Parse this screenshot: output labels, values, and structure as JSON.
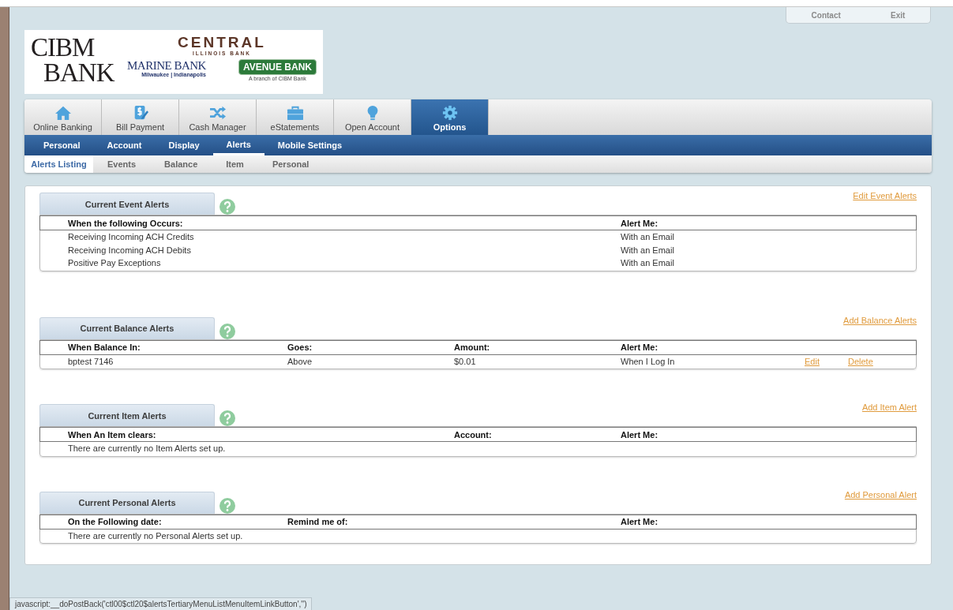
{
  "top_links": [
    {
      "label": "Contact"
    },
    {
      "label": "Exit"
    }
  ],
  "logo": {
    "cibm_line1": "CIBM",
    "cibm_line2": "BANK",
    "central": "CENTRAL",
    "central_sub": "ILLINOIS BANK",
    "marine": "MARINE BANK",
    "marine_sub": "Milwaukee | Indianapolis",
    "avenue": "AVENUE BANK",
    "avenue_sub": "A branch of CIBM Bank"
  },
  "main_tabs": [
    {
      "label": "Online Banking",
      "selected": false
    },
    {
      "label": "Bill Payment",
      "selected": false
    },
    {
      "label": "Cash Manager",
      "selected": false
    },
    {
      "label": "eStatements",
      "selected": false
    },
    {
      "label": "Open Account",
      "selected": false
    },
    {
      "label": "Options",
      "selected": true
    }
  ],
  "secondary_tabs": [
    {
      "label": "Personal",
      "selected": false
    },
    {
      "label": "Account",
      "selected": false
    },
    {
      "label": "Display",
      "selected": false
    },
    {
      "label": "Alerts",
      "selected": true
    },
    {
      "label": "Mobile Settings",
      "selected": false
    }
  ],
  "tertiary_tabs": [
    {
      "label": "Alerts Listing",
      "selected": true
    },
    {
      "label": "Events",
      "selected": false
    },
    {
      "label": "Balance",
      "selected": false
    },
    {
      "label": "Item",
      "selected": false
    },
    {
      "label": "Personal",
      "selected": false
    }
  ],
  "sections": [
    {
      "kind": "event",
      "title": "Current Event Alerts",
      "link": "Edit Event Alerts",
      "columns": [
        "When the following Occurs:",
        "Alert Me:"
      ],
      "rows": [
        {
          "cells": [
            "Receiving Incoming ACH Credits",
            "With an Email"
          ]
        },
        {
          "cells": [
            "Receiving Incoming ACH Debits",
            "With an Email"
          ]
        },
        {
          "cells": [
            "Positive Pay Exceptions",
            "With an Email"
          ]
        }
      ]
    },
    {
      "kind": "balance",
      "title": "Current Balance Alerts",
      "link": "Add Balance Alerts",
      "columns": [
        "When Balance In:",
        "Goes:",
        "Amount:",
        "Alert Me:"
      ],
      "rows": [
        {
          "cells": [
            "bptest 7146",
            "Above",
            "$0.01",
            "When I Log In"
          ],
          "actions": [
            "Edit",
            "Delete"
          ]
        }
      ]
    },
    {
      "kind": "item",
      "title": "Current Item Alerts",
      "link": "Add Item Alert",
      "columns": [
        "When An Item clears:",
        "Account:",
        "Alert Me:"
      ],
      "empty_message": "There are currently no Item Alerts set up."
    },
    {
      "kind": "personal",
      "title": "Current Personal Alerts",
      "link": "Add Personal Alert",
      "columns": [
        "On the Following date:",
        "Remind me of:",
        "Alert Me:"
      ],
      "empty_message": "There are currently no Personal Alerts set up."
    }
  ],
  "status_bar": "javascript:__doPostBack('ctl00$ctl20$alertsTertiaryMenuListMenuItemLinkButton','')"
}
